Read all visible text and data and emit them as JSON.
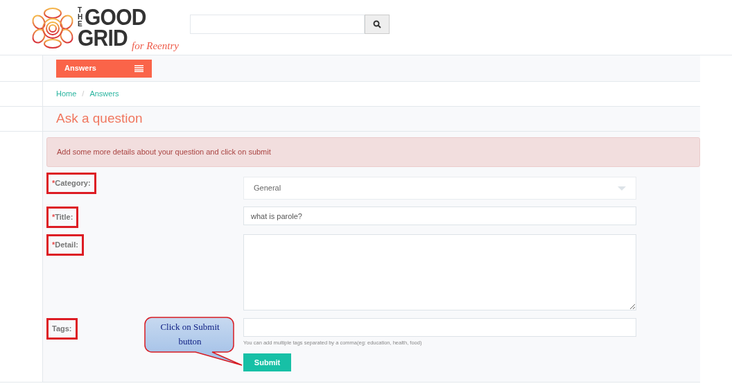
{
  "logo": {
    "the": "THE",
    "good": "GOOD",
    "grid": "GRID",
    "tagline": "for Reentry"
  },
  "menu": {
    "label": "Answers"
  },
  "breadcrumb": {
    "separator": "/",
    "items": [
      {
        "label": "Home"
      },
      {
        "label": "Answers"
      }
    ]
  },
  "page_title": "Ask a question",
  "alert": "Add some more details about your question and click on submit",
  "fields": [
    {
      "kind": "select",
      "label": "Category:",
      "required_mark": "*",
      "highlighted": true,
      "value": "General"
    },
    {
      "kind": "text",
      "label": "Title:",
      "required_mark": "*",
      "highlighted": true,
      "value": "what is parole?"
    },
    {
      "kind": "textarea",
      "label": "Detail:",
      "required_mark": "*",
      "highlighted": true
    },
    {
      "kind": "text",
      "label": "Tags:",
      "highlighted": true,
      "help": "You can add multiple tags separated by a comma(eg: education, health, food)"
    }
  ],
  "submit": "Submit",
  "callout": "Click on Submit button"
}
